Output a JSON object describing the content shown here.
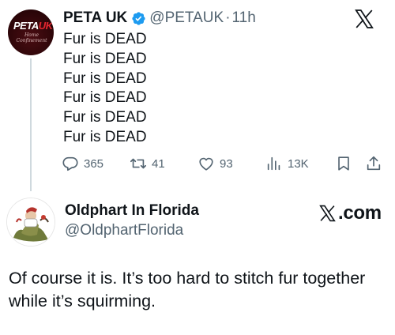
{
  "quoted_tweet": {
    "avatar": {
      "logo_text_white": "PETA",
      "logo_text_red": "UK",
      "tagline": "Home Confinement"
    },
    "author_name": "PETA UK",
    "verified": true,
    "handle": "@PETAUK",
    "separator": "·",
    "time": "11h",
    "lines": [
      "Fur is DEAD",
      "Fur is DEAD",
      "Fur is DEAD",
      "Fur is DEAD",
      "Fur is DEAD",
      "Fur is DEAD"
    ],
    "actions": {
      "replies": "365",
      "reposts": "41",
      "likes": "93",
      "views": "13K"
    },
    "icons": [
      "reply-icon",
      "repost-icon",
      "like-icon",
      "views-icon",
      "bookmark-icon",
      "share-icon"
    ]
  },
  "reply": {
    "author_name": "Oldphart In Florida",
    "handle": "@OldphartFlorida",
    "text": "Of course it is. It’s too hard to stitch fur together while it’s squirming."
  },
  "branding": {
    "site": ".com",
    "brand_color": "#0f1419",
    "verified_color": "#1d9bf0"
  }
}
